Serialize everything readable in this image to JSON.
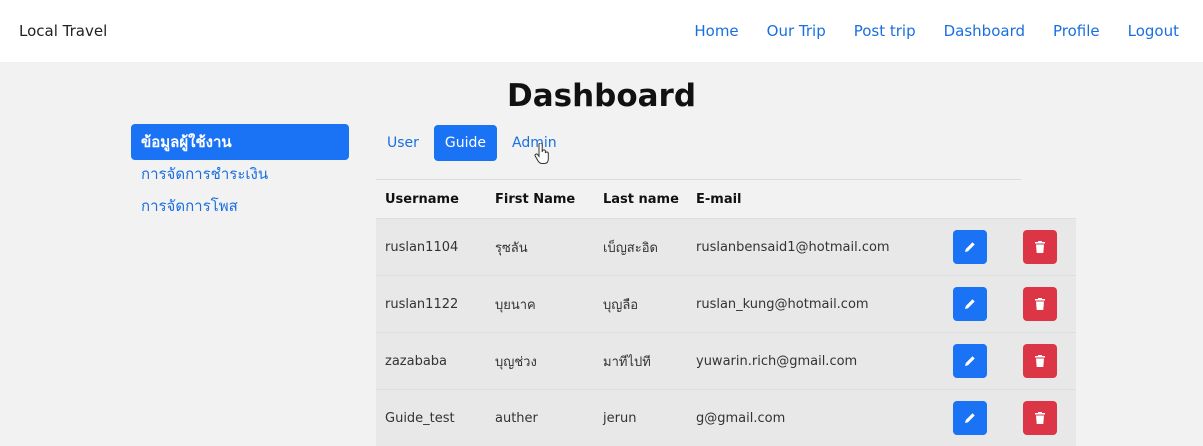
{
  "navbar": {
    "brand": "Local Travel",
    "links": [
      "Home",
      "Our Trip",
      "Post trip",
      "Dashboard",
      "Profile",
      "Logout"
    ]
  },
  "page": {
    "title": "Dashboard"
  },
  "sidebar": {
    "items": [
      {
        "label": "ข้อมูลผู้ใช้งาน",
        "active": true
      },
      {
        "label": "การจัดการชำระเงิน",
        "active": false
      },
      {
        "label": "การจัดการโพส",
        "active": false
      }
    ]
  },
  "tabs": [
    {
      "label": "User",
      "active": false
    },
    {
      "label": "Guide",
      "active": true
    },
    {
      "label": "Admin",
      "active": false
    }
  ],
  "table": {
    "headers": [
      "Username",
      "First Name",
      "Last name",
      "E-mail"
    ],
    "rows": [
      {
        "username": "ruslan1104",
        "first_name": "รุซลัน",
        "last_name": "เบ็ญสะอิด",
        "email": "ruslanbensaid1@hotmail.com"
      },
      {
        "username": "ruslan1122",
        "first_name": "บุยนาค",
        "last_name": "บุญลือ",
        "email": "ruslan_kung@hotmail.com"
      },
      {
        "username": "zazababa",
        "first_name": "บุญช่วง",
        "last_name": "มาทีไปที",
        "email": "yuwarin.rich@gmail.com"
      },
      {
        "username": "Guide_test",
        "first_name": "auther",
        "last_name": "jerun",
        "email": "g@gmail.com"
      }
    ]
  },
  "icons": {
    "edit": "pencil-icon",
    "delete": "trash-icon",
    "cursor": "hand-pointer-icon"
  },
  "colors": {
    "primary": "#1a73f5",
    "link": "#1a6fe0",
    "danger": "#dc3545",
    "background": "#f2f2f2",
    "row": "#e8e8e8"
  }
}
